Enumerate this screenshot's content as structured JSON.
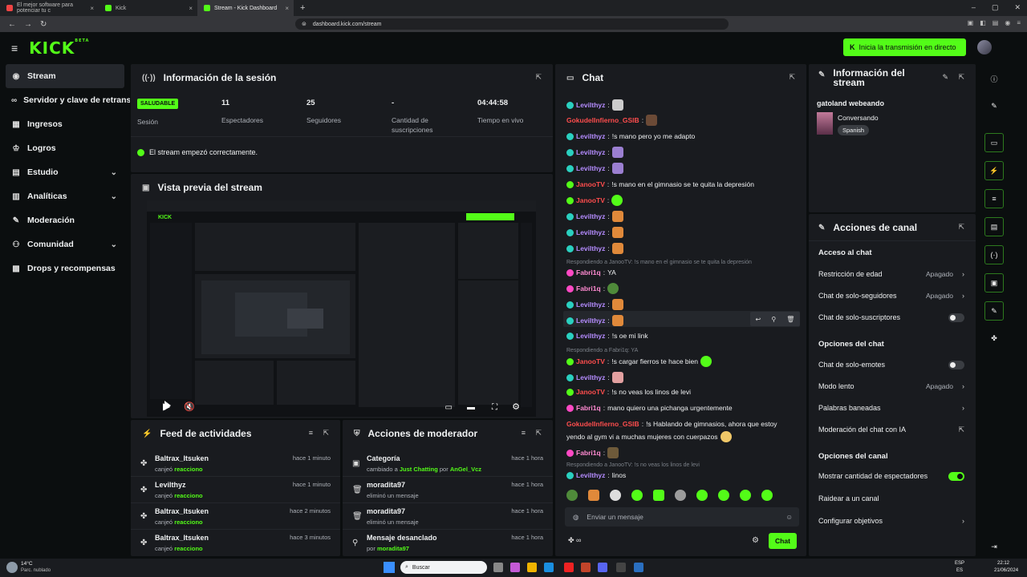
{
  "browser": {
    "tabs": [
      {
        "label": "El mejor software para potenciar tu c"
      },
      {
        "label": "Kick"
      },
      {
        "label": "Stream - Kick Dashboard"
      }
    ],
    "url": "dashboard.kick.com/stream"
  },
  "header": {
    "logo": "KICK",
    "logo_sup": "BETA",
    "go_live": "Inicia la transmisión en directo"
  },
  "sidebar": {
    "items": [
      {
        "label": "Stream"
      },
      {
        "label": "Servidor y clave de retransmisión"
      },
      {
        "label": "Ingresos"
      },
      {
        "label": "Logros"
      },
      {
        "label": "Estudio"
      },
      {
        "label": "Analíticas"
      },
      {
        "label": "Moderación"
      },
      {
        "label": "Comunidad"
      },
      {
        "label": "Drops y recompensas"
      }
    ]
  },
  "session": {
    "title": "Información de la sesión",
    "badge": "SALUDABLE",
    "badge_label": "Sesión",
    "stats": [
      {
        "value": "11",
        "label": "Espectadores"
      },
      {
        "value": "25",
        "label": "Seguidores"
      },
      {
        "value": "-",
        "label": "Cantidad de suscripciones"
      },
      {
        "value": "04:44:58",
        "label": "Tiempo en vivo"
      }
    ],
    "status": "El stream empezó correctamente."
  },
  "preview": {
    "title": "Vista previa del stream"
  },
  "feed": {
    "title": "Feed de actividades",
    "rows": [
      {
        "name": "Baltrax_Itsuken",
        "desc": "canjeó",
        "reward": "reacciono",
        "time": "hace 1 minuto"
      },
      {
        "name": "Levilthyz",
        "desc": "canjeó",
        "reward": "reacciono",
        "time": "hace 1 minuto"
      },
      {
        "name": "Baltrax_Itsuken",
        "desc": "canjeó",
        "reward": "reacciono",
        "time": "hace 2 minutos"
      },
      {
        "name": "Baltrax_Itsuken",
        "desc": "canjeó",
        "reward": "reacciono",
        "time": "hace 3 minutos"
      }
    ]
  },
  "modactions": {
    "title": "Acciones de moderador",
    "rows": [
      {
        "name": "Categoría",
        "desc": "cambiado a",
        "hl1": "Just Chatting",
        "mid": "por",
        "hl2": "AnGel_Vcz",
        "time": "hace 1 hora"
      },
      {
        "name": "moradita97",
        "desc": "eliminó un mensaje",
        "hl1": "",
        "mid": "",
        "hl2": "",
        "time": "hace 1 hora"
      },
      {
        "name": "moradita97",
        "desc": "eliminó un mensaje",
        "hl1": "",
        "mid": "",
        "hl2": "",
        "time": "hace 1 hora"
      },
      {
        "name": "Mensaje desanclado",
        "desc": "por",
        "hl1": "moradita97",
        "mid": "",
        "hl2": "",
        "time": "hace 1 hora"
      }
    ]
  },
  "chat": {
    "title": "Chat",
    "placeholder": "Enviar un mensaje",
    "send": "Chat",
    "messages": [
      {
        "user": "Levilthyz",
        "text": ""
      },
      {
        "user": "GokudelInfierno_GSlB",
        "text": ""
      },
      {
        "user": "Levilthyz",
        "text": "!s mano pero yo me adapto"
      },
      {
        "user": "Levilthyz",
        "text": ""
      },
      {
        "user": "Levilthyz",
        "text": ""
      },
      {
        "user": "JanooTV",
        "text": "!s mano en el gimnasio se te quita la depresión"
      },
      {
        "user": "JanooTV",
        "text": ""
      },
      {
        "user": "Levilthyz",
        "text": ""
      },
      {
        "user": "Levilthyz",
        "text": ""
      },
      {
        "user": "Levilthyz",
        "text": ""
      },
      {
        "user": "Fabri1q",
        "text": "YA"
      },
      {
        "user": "Fabri1q",
        "text": ""
      },
      {
        "user": "Levilthyz",
        "text": ""
      },
      {
        "user": "Levilthyz",
        "text": ""
      },
      {
        "user": "Levilthyz",
        "text": "!s oe mi link"
      },
      {
        "user": "JanooTV",
        "text": "!s cargar fierros te hace bien"
      },
      {
        "user": "Levilthyz",
        "text": ""
      },
      {
        "user": "JanooTV",
        "text": "!s no veas los linos de levi"
      },
      {
        "user": "Fabri1q",
        "text": "mano quiero una pichanga urgentemente"
      },
      {
        "user": "GokudelInfierno_GSlB",
        "text": "!s Hablando de gimnasios, ahora que estoy"
      },
      {
        "user": "",
        "text": "yendo al gym vi a muchas mujeres con cuerpazos"
      },
      {
        "user": "Fabri1q",
        "text": ""
      },
      {
        "user": "Levilthyz",
        "text": "linos"
      }
    ],
    "replies": [
      "Respondiendo a JanooTV: !s mano en el gimnasio se te quita la depresión",
      "Respondiendo a Fabri1q: YA",
      "Respondiendo a JanooTV: !s no veas los linos de levi"
    ]
  },
  "streaminfo": {
    "title": "Información del stream",
    "stream_title": "gatoland webeando",
    "category": "Conversando",
    "tag": "Spanish"
  },
  "channel": {
    "title": "Acciones de canal",
    "sections": [
      {
        "label": "Acceso al chat"
      },
      {
        "label": "Opciones del chat"
      },
      {
        "label": "Opciones del canal"
      }
    ],
    "rows": [
      {
        "label": "Restricción de edad",
        "value": "Apagado"
      },
      {
        "label": "Chat de solo-seguidores",
        "value": "Apagado"
      },
      {
        "label": "Chat de solo-suscriptores",
        "value": ""
      },
      {
        "label": "Chat de solo-emotes",
        "value": ""
      },
      {
        "label": "Modo lento",
        "value": "Apagado"
      },
      {
        "label": "Palabras baneadas",
        "value": ""
      },
      {
        "label": "Moderación del chat con IA",
        "value": ""
      },
      {
        "label": "Mostrar cantidad de espectadores",
        "value": ""
      },
      {
        "label": "Raidear a un canal",
        "value": ""
      },
      {
        "label": "Configurar objetivos",
        "value": ""
      }
    ]
  },
  "taskbar": {
    "temp": "14°C",
    "weather": "Parc. nublado",
    "search": "Buscar",
    "lang": "ESP",
    "lang2": "ES",
    "time": "22:12",
    "date": "21/06/2024"
  }
}
